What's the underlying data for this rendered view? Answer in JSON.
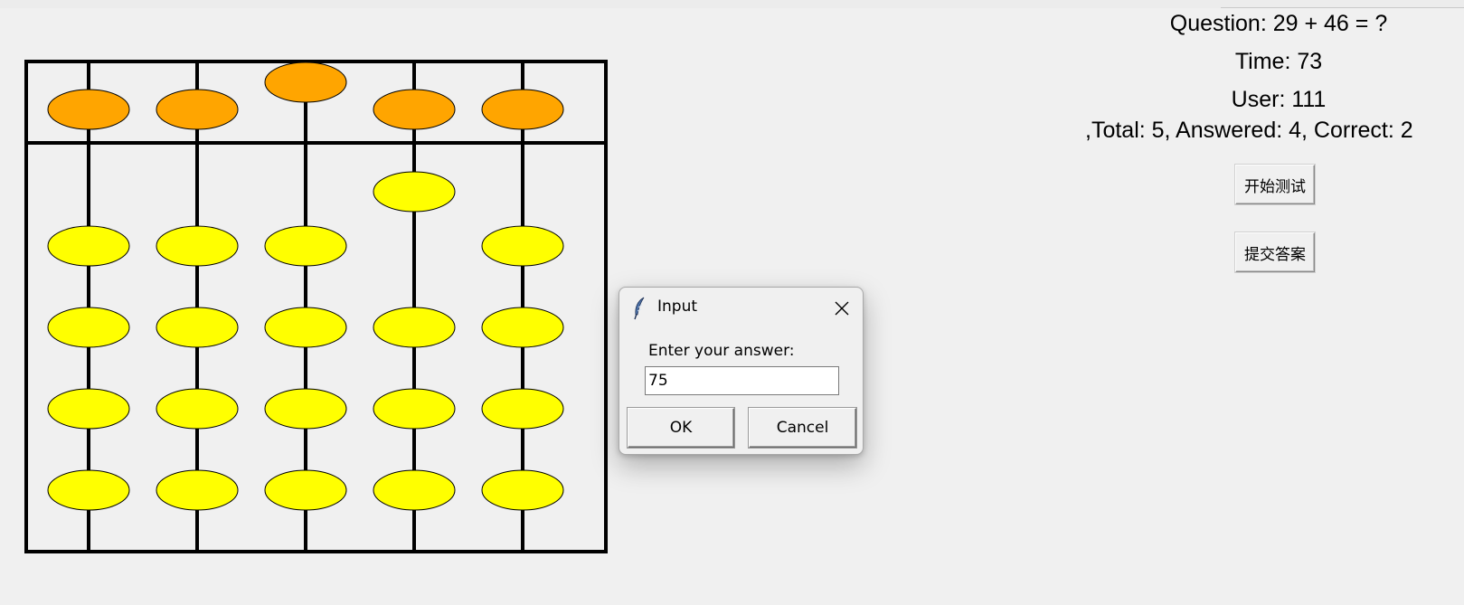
{
  "quiz": {
    "question": "Question: 29 + 46 = ?",
    "time": "Time: 73",
    "user": "User: 111",
    "stats": ",Total: 5, Answered: 4, Correct: 2",
    "start_button": "开始测试",
    "submit_button": "提交答案"
  },
  "abacus": {
    "rods": 5,
    "rod_digits": [
      0,
      0,
      5,
      1,
      0
    ],
    "heaven_bead_color": "#ffa500",
    "earth_bead_color": "#ffff00",
    "frame_color": "#000000"
  },
  "dialog": {
    "title": "Input",
    "prompt": "Enter your answer:",
    "value": "75",
    "ok_label": "OK",
    "cancel_label": "Cancel"
  },
  "icons": {
    "dialog_icon": "feather-icon",
    "close": "close-icon"
  }
}
